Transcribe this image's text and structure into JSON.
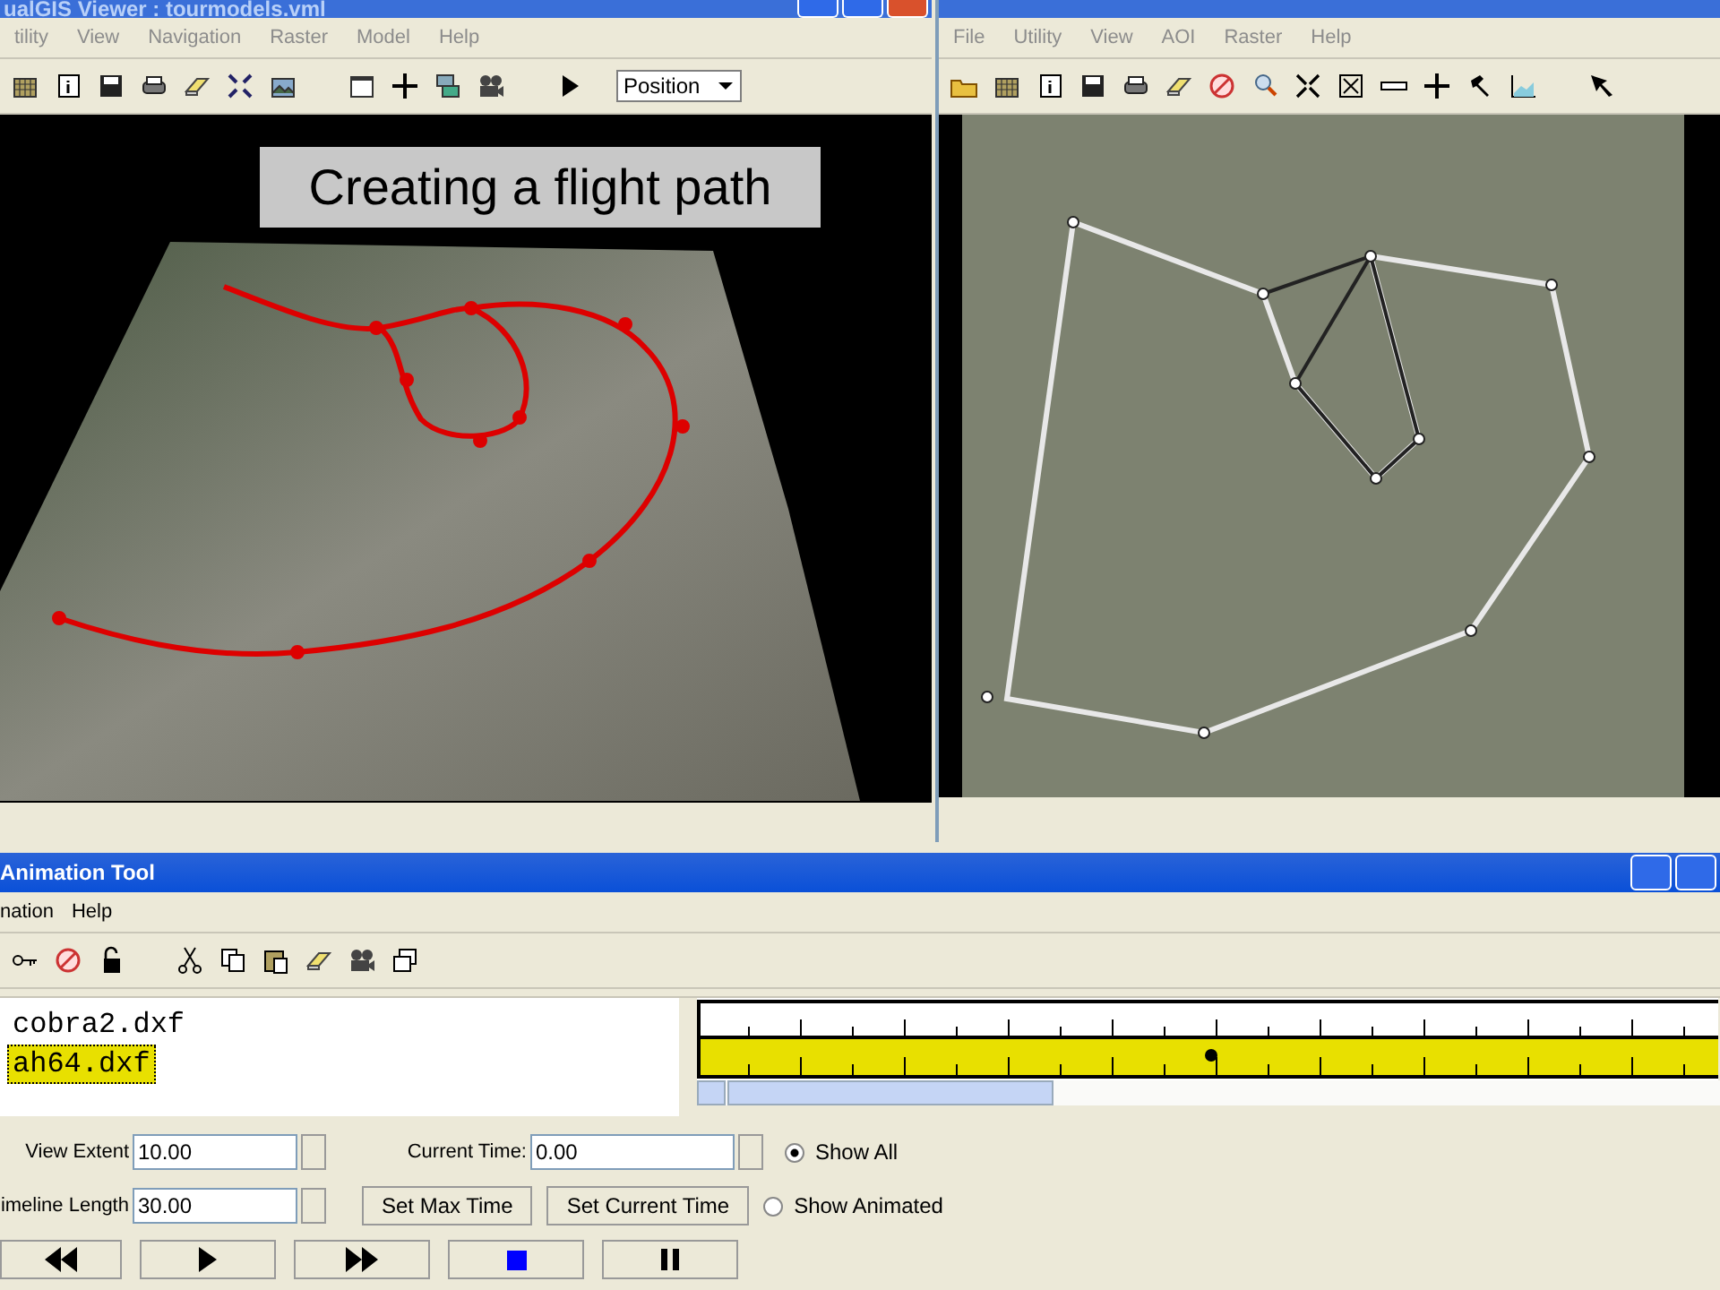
{
  "left_viewer": {
    "title": "ualGIS Viewer : tourmodels.vml",
    "menu": [
      "tility",
      "View",
      "Navigation",
      "Raster",
      "Model",
      "Help"
    ],
    "mode_dropdown": {
      "value": "Position"
    },
    "caption": "Creating a flight path"
  },
  "right_viewer": {
    "menu": [
      "File",
      "Utility",
      "View",
      "AOI",
      "Raster",
      "Help"
    ]
  },
  "animation_tool": {
    "title": "Animation Tool",
    "menu": [
      "nation",
      "Help"
    ],
    "layers": [
      {
        "name": "cobra2.dxf",
        "selected": false
      },
      {
        "name": "ah64.dxf",
        "selected": true
      }
    ],
    "view_extent": {
      "label": "View Extent",
      "value": "10.00"
    },
    "current_time": {
      "label": "Current Time:",
      "value": "0.00"
    },
    "timeline_length": {
      "label": "imeline Length",
      "value": "30.00"
    },
    "buttons": [
      "Set Max Time",
      "Set Current Time"
    ],
    "display": [
      {
        "label": "Show All",
        "selected": true
      },
      {
        "label": "Show Animated",
        "selected": false
      }
    ]
  }
}
